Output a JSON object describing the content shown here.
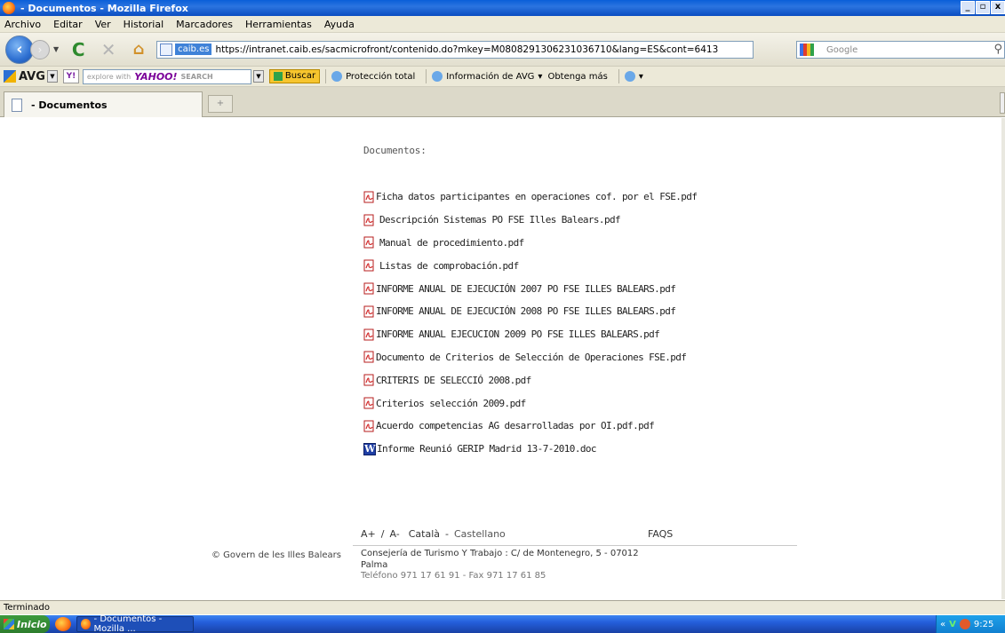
{
  "window": {
    "title": " - Documentos - Mozilla Firefox",
    "controls": [
      "_",
      "▫",
      "x"
    ]
  },
  "menu": [
    "Archivo",
    "Editar",
    "Ver",
    "Historial",
    "Marcadores",
    "Herramientas",
    "Ayuda"
  ],
  "nav": {
    "site_badge": "caib.es",
    "url": "https://intranet.caib.es/sacmicrofront/contenido.do?mkey=M0808291306231036710&lang=ES&cont=6413",
    "search_placeholder": "Google"
  },
  "avg_toolbar": {
    "logo": "AVG",
    "yahoo_prefix": "explore with",
    "yahoo_brand": "YAHOO!",
    "yahoo_search": "SEARCH",
    "buscar": "Buscar",
    "proteccion": "Protección total",
    "informacion": "Información de AVG",
    "obtenga": "Obtenga más"
  },
  "tab": {
    "label": " - Documentos",
    "new_tab": "+"
  },
  "content": {
    "section_title": "Documentos:",
    "documents": [
      {
        "name": "Ficha datos participantes en operaciones cof. por el FSE.pdf",
        "type": "pdf"
      },
      {
        "name": "Descripción Sistemas PO FSE Illes Balears.pdf",
        "type": "pdf"
      },
      {
        "name": "Manual de procedimiento.pdf",
        "type": "pdf"
      },
      {
        "name": "Listas de comprobación.pdf",
        "type": "pdf"
      },
      {
        "name": "INFORME ANUAL DE EJECUCIÓN 2007 PO FSE ILLES BALEARS.pdf",
        "type": "pdf"
      },
      {
        "name": "INFORME ANUAL DE EJECUCIÓN 2008 PO FSE ILLES BALEARS.pdf",
        "type": "pdf"
      },
      {
        "name": "INFORME ANUAL EJECUCION 2009 PO FSE ILLES BALEARS.pdf",
        "type": "pdf"
      },
      {
        "name": "Documento de Criterios de Selección de Operaciones FSE.pdf",
        "type": "pdf"
      },
      {
        "name": "CRITERIS DE SELECCIÓ 2008.pdf",
        "type": "pdf"
      },
      {
        "name": "Criterios selección 2009.pdf",
        "type": "pdf"
      },
      {
        "name": "Acuerdo competencias AG desarrolladas por OI.pdf.pdf",
        "type": "pdf"
      },
      {
        "name": "Informe Reunió GERIP Madrid 13-7-2010.doc",
        "type": "doc"
      }
    ]
  },
  "footer": {
    "font_increase": "A+",
    "font_sep": "/",
    "font_decrease": "A-",
    "lang_catala": "Català",
    "lang_sep": "-",
    "lang_castellano": "Castellano",
    "faqs": "FAQS",
    "govern": "© Govern de les Illes Balears",
    "address_line1": "Consejería de Turismo Y Trabajo : C/ de Montenegro, 5 - 07012",
    "address_line2": "Palma",
    "phone": "Teléfono 971 17 61 91 - Fax 971 17 61 85"
  },
  "status": "Terminado",
  "taskbar": {
    "start": "Inicio",
    "item": " - Documentos - Mozilla ...",
    "clock": "9:25",
    "tray_arrows": "«"
  }
}
